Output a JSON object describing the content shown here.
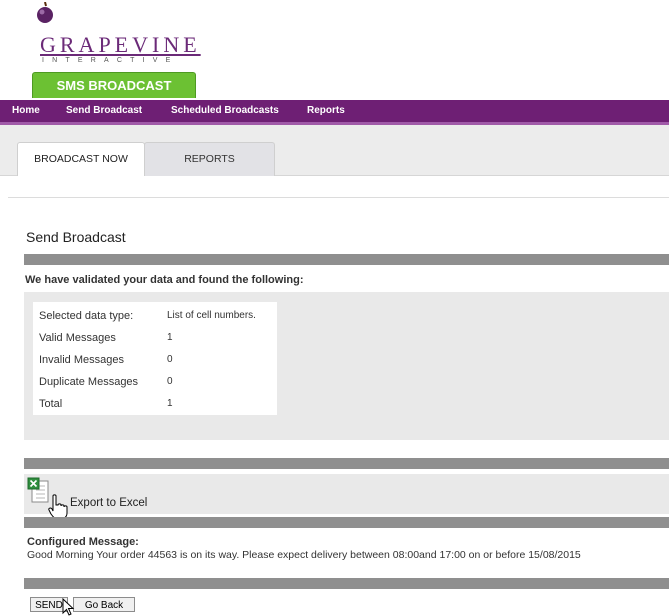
{
  "brand": {
    "name": "GRAPEVINE",
    "subtitle": "INTERACTIVE",
    "product": "SMS BROADCAST",
    "colors": {
      "purple": "#6e1f74",
      "green": "#6cc133"
    }
  },
  "nav": {
    "items": [
      "Home",
      "Send Broadcast",
      "Scheduled Broadcasts",
      "Reports"
    ]
  },
  "tabs": {
    "broadcast_now": "BROADCAST NOW",
    "reports": "REPORTS",
    "active": "BROADCAST NOW"
  },
  "page": {
    "title": "Send Broadcast",
    "validated_text": "We have validated your data and found the following:"
  },
  "summary": {
    "rows": [
      {
        "label": "Selected data type:",
        "value": "List of cell numbers."
      },
      {
        "label": "Valid Messages",
        "value": "1"
      },
      {
        "label": "Invalid Messages",
        "value": "0"
      },
      {
        "label": "Duplicate Messages",
        "value": "0"
      },
      {
        "label": "Total",
        "value": "1"
      }
    ]
  },
  "export": {
    "label": "Export to Excel",
    "icon": "excel-file-icon"
  },
  "configured": {
    "label": "Configured Message:",
    "message": "Good Morning Your order 44563 is on its way. Please expect delivery between 08:00and 17:00 on or before 15/08/2015"
  },
  "buttons": {
    "send": "SEND",
    "go_back": "Go Back"
  }
}
